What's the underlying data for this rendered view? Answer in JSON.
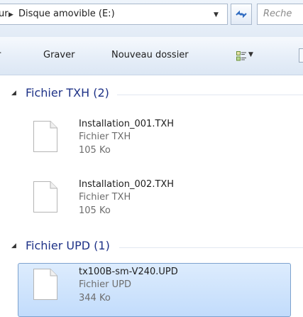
{
  "address_bar": {
    "prev_segment": "ur",
    "current_segment": "Disque amovible (E:)",
    "search_placeholder": "Reche"
  },
  "toolbar": {
    "prev_command": "r",
    "burn_label": "Graver",
    "new_folder_label": "Nouveau dossier"
  },
  "groups": [
    {
      "title": "Fichier TXH (2)",
      "items": [
        {
          "name": "Installation_001.TXH",
          "type": "Fichier TXH",
          "size": "105 Ko",
          "selected": false
        },
        {
          "name": "Installation_002.TXH",
          "type": "Fichier TXH",
          "size": "105 Ko",
          "selected": false
        }
      ]
    },
    {
      "title": "Fichier UPD (1)",
      "items": [
        {
          "name": "tx100B-sm-V240.UPD",
          "type": "Fichier UPD",
          "size": "344 Ko",
          "selected": true
        }
      ]
    }
  ],
  "icons": {
    "breadcrumb_separator": "chevron-right-icon",
    "dropdown": "chevron-down-icon",
    "refresh": "refresh-icon",
    "view": "view-options-icon",
    "collapse": "collapse-triangle-icon",
    "file": "file-icon"
  },
  "colors": {
    "group_title": "#1e3287",
    "selection_fill": "#c2dcfc",
    "selection_border": "#7da2ce",
    "secondary_text": "#6d6d6d"
  }
}
